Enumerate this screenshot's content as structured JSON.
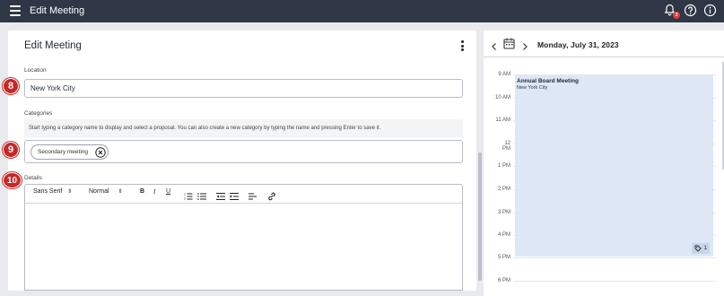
{
  "app": {
    "title": "Edit Meeting"
  },
  "header": {
    "notification_count": "3",
    "icons": [
      "menu-icon",
      "bell-icon",
      "help-icon",
      "info-icon"
    ]
  },
  "form": {
    "title": "Edit Meeting",
    "location": {
      "label": "Location",
      "value": "New York City"
    },
    "categories": {
      "label": "Categories",
      "hint": "Start typing a category name to display and select a proposal. You can also create a new category by typing the name and pressing Enter to save it.",
      "chips": [
        "Secondary meeting"
      ]
    },
    "details": {
      "label": "Details",
      "toolbar": {
        "font": "Sans Serif",
        "size": "Normal",
        "bold": "B",
        "italic": "I",
        "underline": "U"
      }
    }
  },
  "markers": [
    "8",
    "9",
    "10"
  ],
  "calendar": {
    "date": "Monday, July 31, 2023",
    "times": [
      "9 AM",
      "10 AM",
      "11 AM",
      "12 PM",
      "1 PM",
      "2 PM",
      "3 PM",
      "4 PM",
      "5 PM",
      "6 PM"
    ],
    "event": {
      "title": "Annual Board Meeting",
      "location": "New York City",
      "tag_count": "1"
    }
  },
  "colors": {
    "topbar": "#2f3747",
    "event": "#dde7f6",
    "marker": "#c62828"
  }
}
